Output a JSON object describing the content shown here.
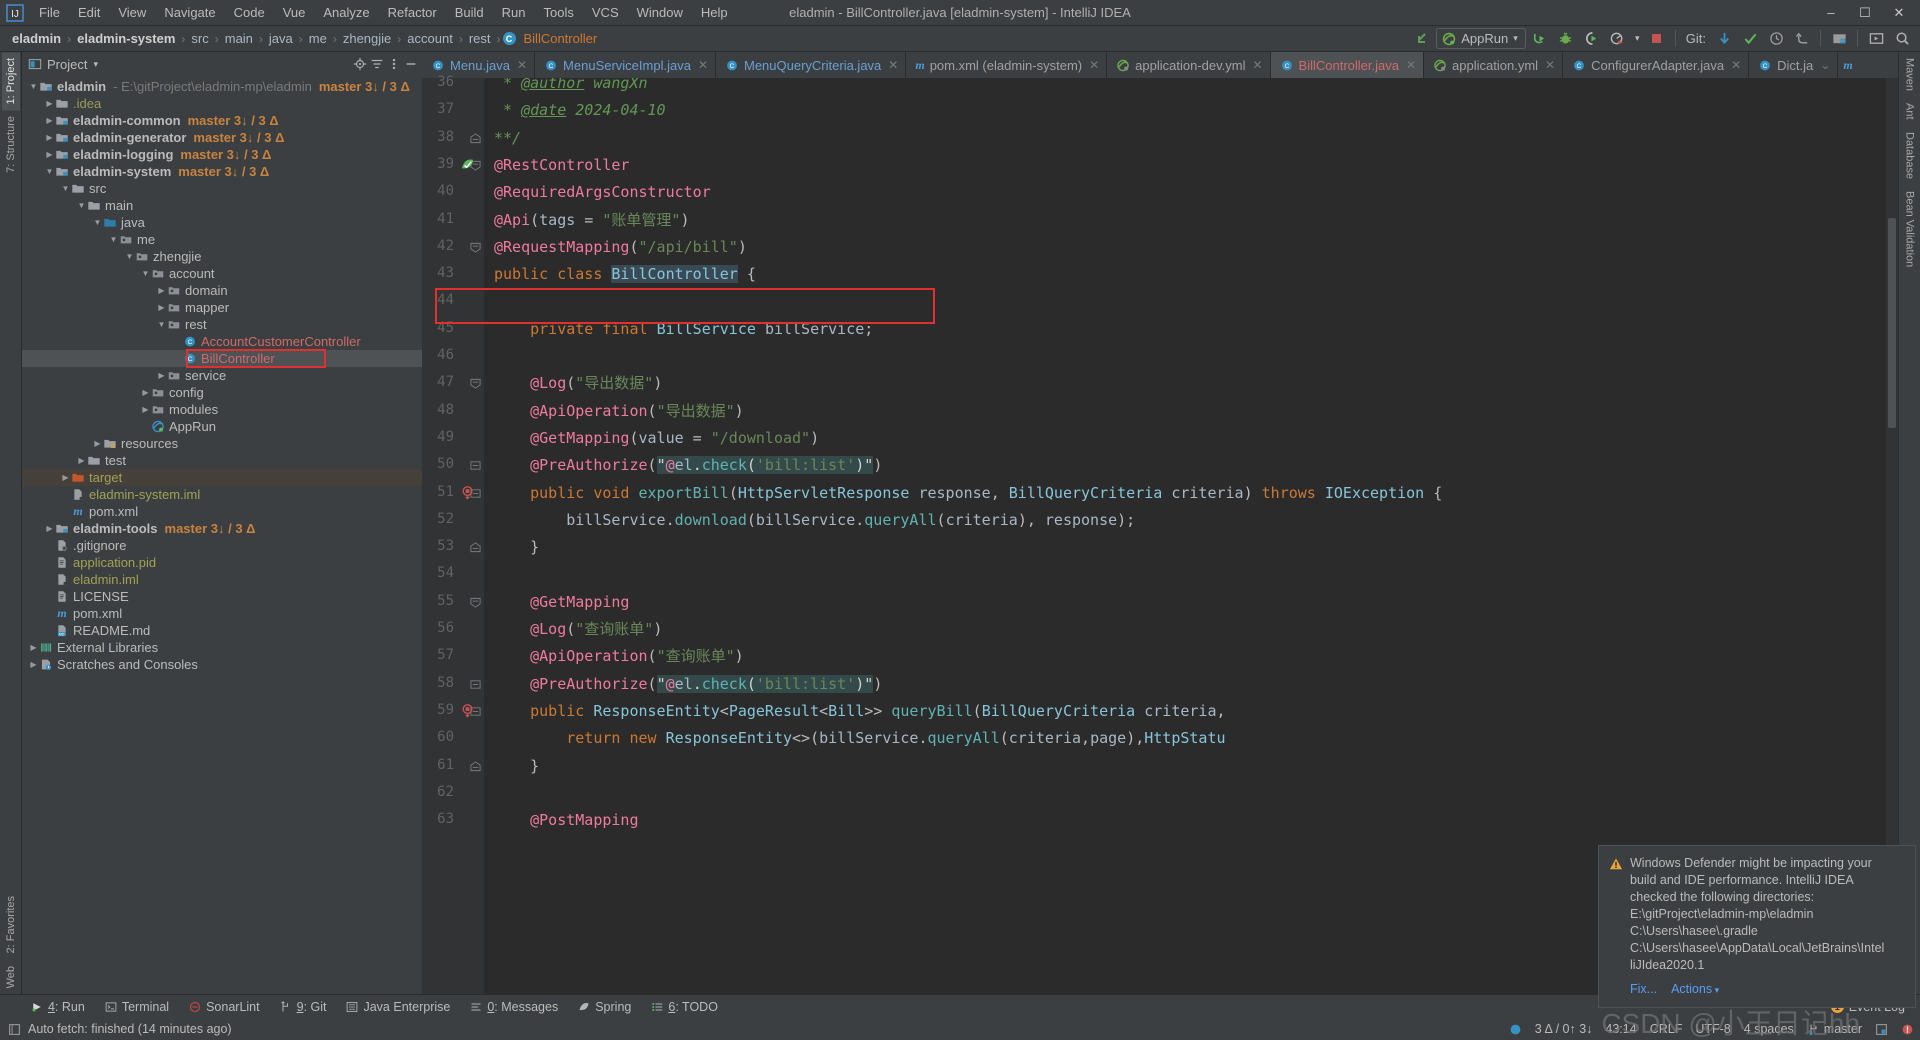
{
  "window": {
    "title": "eladmin - BillController.java [eladmin-system] - IntelliJ IDEA",
    "minimize": "–",
    "maximize": "☐",
    "close": "✕"
  },
  "menu": {
    "items": [
      "File",
      "Edit",
      "View",
      "Navigate",
      "Code",
      "Vue",
      "Analyze",
      "Refactor",
      "Build",
      "Run",
      "Tools",
      "VCS",
      "Window",
      "Help"
    ]
  },
  "breadcrumb": {
    "items": [
      "eladmin",
      "eladmin-system",
      "src",
      "main",
      "java",
      "me",
      "zhengjie",
      "account",
      "rest"
    ],
    "current_class": "BillController",
    "class_icon": "C",
    "separator": "›"
  },
  "toolbar": {
    "back_arrow_icon": "back-arrow-icon",
    "run_config": "AppRun",
    "run_config_chevron": "▾",
    "run_icon": "run-icon",
    "debug_icon": "debug-icon",
    "coverage_icon": "run-with-coverage-icon",
    "profiler_icon": "profiler-icon",
    "profiler_chevron": "▾",
    "stop_icon": "stop-icon",
    "git_label": "Git:",
    "git_update_icon": "git-update-project-icon",
    "git_commit_icon": "git-commit-icon",
    "git_history_icon": "git-history-icon",
    "git_rollback_icon": "git-rollback-icon",
    "project_structure_icon": "project-structure-icon",
    "select_opened_file_icon": "select-opened-file-icon",
    "search_everywhere_icon": "search-everywhere-icon"
  },
  "left_rail": {
    "top": [
      "1: Project",
      "7: Structure"
    ],
    "bottom": [
      "2: Favorites",
      "Web"
    ]
  },
  "right_rail": {
    "items": [
      "Maven",
      "Ant",
      "Database",
      "Bean Validation"
    ]
  },
  "project_panel": {
    "title": "Project",
    "chevron": "▾",
    "locate_icon": "locate-file-icon",
    "collapse_icon": "collapse-all-icon",
    "settings_icon": "panel-options-icon",
    "hide_icon": "hide-panel-icon",
    "tree": [
      {
        "depth": 0,
        "arrow": "down",
        "icon": "module-folder",
        "label": "eladmin",
        "bold": true,
        "path": "- E:\\gitProject\\eladmin-mp\\eladmin",
        "branch": "master 3↓ / 3 Δ"
      },
      {
        "depth": 1,
        "arrow": "right",
        "icon": "folder",
        "label": ".idea",
        "color": "yellow"
      },
      {
        "depth": 1,
        "arrow": "right",
        "icon": "module-folder",
        "label": "eladmin-common",
        "bold": true,
        "branch": "master 3↓ / 3 Δ"
      },
      {
        "depth": 1,
        "arrow": "right",
        "icon": "module-folder",
        "label": "eladmin-generator",
        "bold": true,
        "branch": "master 3↓ / 3 Δ"
      },
      {
        "depth": 1,
        "arrow": "right",
        "icon": "module-folder",
        "label": "eladmin-logging",
        "bold": true,
        "branch": "master 3↓ / 3 Δ"
      },
      {
        "depth": 1,
        "arrow": "down",
        "icon": "module-folder",
        "label": "eladmin-system",
        "bold": true,
        "branch": "master 3↓ / 3 Δ"
      },
      {
        "depth": 2,
        "arrow": "down",
        "icon": "folder",
        "label": "src"
      },
      {
        "depth": 3,
        "arrow": "down",
        "icon": "folder",
        "label": "main"
      },
      {
        "depth": 4,
        "arrow": "down",
        "icon": "source-folder",
        "label": "java"
      },
      {
        "depth": 5,
        "arrow": "down",
        "icon": "package",
        "label": "me"
      },
      {
        "depth": 6,
        "arrow": "down",
        "icon": "package",
        "label": "zhengjie"
      },
      {
        "depth": 7,
        "arrow": "down",
        "icon": "package",
        "label": "account"
      },
      {
        "depth": 8,
        "arrow": "right",
        "icon": "package",
        "label": "domain"
      },
      {
        "depth": 8,
        "arrow": "right",
        "icon": "package",
        "label": "mapper"
      },
      {
        "depth": 8,
        "arrow": "down",
        "icon": "package",
        "label": "rest"
      },
      {
        "depth": 9,
        "arrow": "none",
        "icon": "class",
        "label": "AccountCustomerController",
        "color": "red"
      },
      {
        "depth": 9,
        "arrow": "none",
        "icon": "class",
        "label": "BillController",
        "color": "red",
        "selected": true,
        "boxed": true
      },
      {
        "depth": 8,
        "arrow": "right",
        "icon": "package",
        "label": "service"
      },
      {
        "depth": 7,
        "arrow": "right",
        "icon": "package",
        "label": "config"
      },
      {
        "depth": 7,
        "arrow": "right",
        "icon": "package",
        "label": "modules"
      },
      {
        "depth": 7,
        "arrow": "none",
        "icon": "springboot",
        "label": "AppRun"
      },
      {
        "depth": 4,
        "arrow": "right",
        "icon": "resource-folder",
        "label": "resources"
      },
      {
        "depth": 3,
        "arrow": "right",
        "icon": "folder",
        "label": "test"
      },
      {
        "depth": 2,
        "arrow": "right",
        "icon": "excluded-folder",
        "label": "target",
        "color": "olive",
        "highlighted": true
      },
      {
        "depth": 2,
        "arrow": "none",
        "icon": "iml",
        "label": "eladmin-system.iml",
        "color": "olive"
      },
      {
        "depth": 2,
        "arrow": "none",
        "icon": "maven",
        "label": "pom.xml"
      },
      {
        "depth": 1,
        "arrow": "right",
        "icon": "module-folder",
        "label": "eladmin-tools",
        "bold": true,
        "branch": "master 3↓ / 3 Δ"
      },
      {
        "depth": 1,
        "arrow": "none",
        "icon": "gitignore",
        "label": ".gitignore"
      },
      {
        "depth": 1,
        "arrow": "none",
        "icon": "file",
        "label": "application.pid",
        "color": "olive"
      },
      {
        "depth": 1,
        "arrow": "none",
        "icon": "iml",
        "label": "eladmin.iml",
        "color": "olive"
      },
      {
        "depth": 1,
        "arrow": "none",
        "icon": "file",
        "label": "LICENSE"
      },
      {
        "depth": 1,
        "arrow": "none",
        "icon": "maven",
        "label": "pom.xml"
      },
      {
        "depth": 1,
        "arrow": "none",
        "icon": "markdown",
        "label": "README.md"
      },
      {
        "depth": 0,
        "arrow": "right",
        "icon": "libraries",
        "label": "External Libraries"
      },
      {
        "depth": 0,
        "arrow": "right",
        "icon": "scratches",
        "label": "Scratches and Consoles"
      }
    ]
  },
  "editor_tabs": [
    {
      "label": "Menu.java",
      "icon": "class",
      "color": "blue",
      "active": false,
      "close": "✕"
    },
    {
      "label": "MenuServiceImpl.java",
      "icon": "class",
      "color": "blue",
      "active": false,
      "close": "✕"
    },
    {
      "label": "MenuQueryCriteria.java",
      "icon": "class",
      "color": "blue",
      "active": false,
      "close": "✕"
    },
    {
      "label": "pom.xml (eladmin-system)",
      "icon": "maven",
      "color": "plain",
      "active": false,
      "close": "✕"
    },
    {
      "label": "application-dev.yml",
      "icon": "springyaml",
      "color": "plain",
      "active": false,
      "close": "✕"
    },
    {
      "label": "BillController.java",
      "icon": "class",
      "color": "red",
      "active": true,
      "close": "✕"
    },
    {
      "label": "application.yml",
      "icon": "springyaml",
      "color": "plain",
      "active": false,
      "close": "✕"
    },
    {
      "label": "ConfigurerAdapter.java",
      "icon": "class",
      "color": "plain",
      "active": false,
      "close": "✕"
    },
    {
      "label": "Dict.ja",
      "icon": "class",
      "color": "plain",
      "active": false,
      "close": "⌄"
    }
  ],
  "code": {
    "first_line": 36,
    "lines": [
      {
        "n": 36,
        "partial": true
      },
      {
        "n": 37
      },
      {
        "n": 38,
        "fold": "end"
      },
      {
        "n": 39,
        "fold": "start",
        "gutter_icon": "spring-bean-icon"
      },
      {
        "n": 40
      },
      {
        "n": 41
      },
      {
        "n": 42,
        "fold": "start"
      },
      {
        "n": 43
      },
      {
        "n": 44
      },
      {
        "n": 45
      },
      {
        "n": 46
      },
      {
        "n": 47,
        "fold": "start"
      },
      {
        "n": 48
      },
      {
        "n": 49
      },
      {
        "n": 50,
        "fold": "mid"
      },
      {
        "n": 51,
        "fold": "mid",
        "gutter_icon": "request-mapping-icon"
      },
      {
        "n": 52
      },
      {
        "n": 53,
        "fold": "end"
      },
      {
        "n": 54
      },
      {
        "n": 55,
        "fold": "start"
      },
      {
        "n": 56
      },
      {
        "n": 57
      },
      {
        "n": 58,
        "fold": "mid"
      },
      {
        "n": 59,
        "fold": "mid",
        "gutter_icon": "request-mapping-icon"
      },
      {
        "n": 60
      },
      {
        "n": 61,
        "fold": "end"
      },
      {
        "n": 62
      },
      {
        "n": 63
      }
    ],
    "text": [
      " * @author wangXn",
      " * @date 2024-04-10",
      "**/",
      "@RestController",
      "@RequiredArgsConstructor",
      "@Api(tags = \"账单管理\")",
      "@RequestMapping(\"/api/bill\")",
      "public class BillController {",
      "",
      "    private final BillService billService;",
      "",
      "    @Log(\"导出数据\")",
      "    @ApiOperation(\"导出数据\")",
      "    @GetMapping(value = \"/download\")",
      "    @PreAuthorize(\"@el.check('bill:list')\")",
      "    public void exportBill(HttpServletResponse response, BillQueryCriteria criteria) throws IOException {",
      "        billService.download(billService.queryAll(criteria), response);",
      "    }",
      "",
      "    @GetMapping",
      "    @Log(\"查询账单\")",
      "    @ApiOperation(\"查询账单\")",
      "    @PreAuthorize(\"@el.check('bill:list')\")",
      "    public ResponseEntity<PageResult<Bill>> queryBill(BillQueryCriteria criteria,",
      "        return new ResponseEntity<>(billService.queryAll(criteria,page),HttpStatu",
      "    }",
      "",
      "    @PostMapping"
    ]
  },
  "annotations": {
    "highlight_color": "#e03030",
    "boxes": [
      "bill-controller-tree-node",
      "preauthorize-line-50"
    ]
  },
  "notification": {
    "warning_icon": "warning-triangle-icon",
    "text": "Windows Defender might be impacting your build and IDE performance. IntelliJ IDEA checked the following directories: E:\\gitProject\\eladmin-mp\\eladmin C:\\Users\\hasee\\.gradle C:\\Users\\hasee\\AppData\\Local\\JetBrains\\IntelliJIdea2020.1",
    "lines": [
      "Windows Defender might be impacting your",
      "build and IDE performance. IntelliJ IDEA",
      "checked the following directories:",
      "E:\\gitProject\\eladmin-mp\\eladmin",
      "C:\\Users\\hasee\\.gradle",
      "C:\\Users\\hasee\\AppData\\Local\\JetBrains\\Intel",
      "liJIdea2020.1"
    ],
    "fix_label": "Fix...",
    "actions_label": "Actions",
    "actions_chevron": "▾"
  },
  "bottom_bar": {
    "tabs": [
      {
        "label": "4: Run",
        "mnemonic": "4",
        "icon": "run-icon"
      },
      {
        "label": "Terminal",
        "icon": "terminal-icon"
      },
      {
        "label": "SonarLint",
        "icon": "sonarlint-icon"
      },
      {
        "label": "9: Git",
        "mnemonic": "9",
        "icon": "git-icon"
      },
      {
        "label": "Java Enterprise",
        "icon": "java-enterprise-icon"
      },
      {
        "label": "0: Messages",
        "mnemonic": "0",
        "icon": "messages-icon"
      },
      {
        "label": "Spring",
        "icon": "spring-icon"
      },
      {
        "label": "6: TODO",
        "mnemonic": "6",
        "icon": "todo-icon"
      }
    ]
  },
  "status_bar": {
    "message_icon": "console-icon",
    "message": "Auto fetch: finished (14 minutes ago)",
    "problems": "3 Δ / 0↑ 3↓",
    "caret": "43:14",
    "line_separator": "CRLF",
    "encoding": "UTF-8",
    "indent": "4 spaces",
    "branch": "master",
    "event_log": "Event Log",
    "event_log_badge": "1",
    "watermark": "CSDN @小王日记hh",
    "db_icon": "database-indicator-icon",
    "inspection_icon": "inspection-icon",
    "error_icon": "error-indicator-icon"
  }
}
